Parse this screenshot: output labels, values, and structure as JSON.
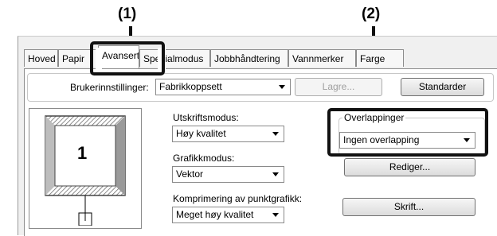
{
  "callouts": {
    "c1": "(1)",
    "c2": "(2)"
  },
  "tabs": {
    "hoved": "Hoved",
    "papir": "Papir",
    "avansert": "Avansert",
    "spesialmodus": "Spesialmodus",
    "jobb": "Jobbhåndtering",
    "vannmerker": "Vannmerker",
    "farge": "Farge"
  },
  "user_settings": {
    "label": "Brukerinnstillinger:",
    "value": "Fabrikkoppsett",
    "save": "Lagre...",
    "defaults": "Standarder"
  },
  "preview": {
    "page_number": "1"
  },
  "print_mode": {
    "label": "Utskriftsmodus:",
    "value": "Høy kvalitet"
  },
  "graphics_mode": {
    "label": "Grafikkmodus:",
    "value": "Vektor"
  },
  "compression": {
    "label": "Komprimering av punktgrafikk:",
    "value": "Meget høy kvalitet"
  },
  "overlays": {
    "label": "Overlappinger",
    "value": "Ingen overlapping",
    "edit": "Rediger..."
  },
  "font_button": "Skrift..."
}
